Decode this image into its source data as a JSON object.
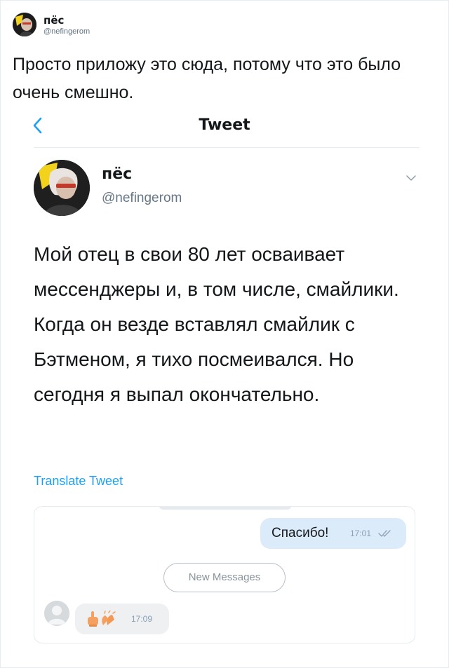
{
  "post": {
    "author_name": "пёс",
    "author_handle": "@nefingerom",
    "text": "Просто приложу это сюда, потому что это было очень смешно."
  },
  "screenshot": {
    "header_title": "Tweet",
    "tweet": {
      "author_name": "пёс",
      "author_handle": "@nefingerom",
      "text": "Мой отец в свои 80 лет осваивает мессенджеры и, в том числе, смайлики. Когда он везде вставлял смайлик с Бэтменом, я тихо посмеивался. Но сегодня я выпал окончательно.",
      "translate_label": "Translate Tweet"
    },
    "chat": {
      "outgoing": {
        "text": "Спасибо!",
        "time": "17:01"
      },
      "divider_label": "New Messages",
      "incoming": {
        "time": "17:09",
        "icons": [
          "middle-finger-emoji",
          "clapping-hands-emoji"
        ]
      }
    }
  },
  "colors": {
    "link": "#1da1f2",
    "muted": "#657786",
    "outgoing_bubble": "#dcebfa",
    "incoming_bubble": "#eef0f2",
    "divider": "#e6ecf0"
  }
}
